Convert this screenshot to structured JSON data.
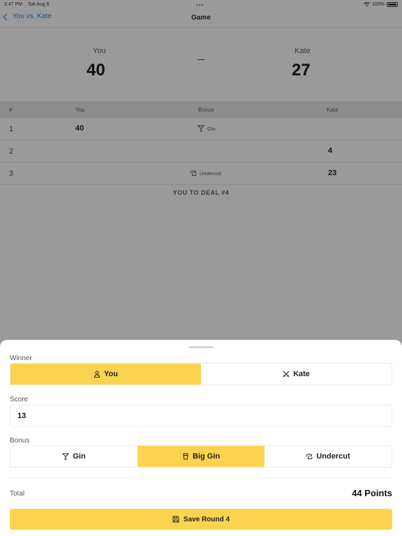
{
  "status_bar": {
    "time": "2:47 PM",
    "date": "Sat Aug 6",
    "battery": "100%"
  },
  "nav": {
    "back_label": "You vs. Kate",
    "title": "Game"
  },
  "scoreboard": {
    "you": {
      "name": "You",
      "score": "40"
    },
    "kate": {
      "name": "Kate",
      "score": "27"
    }
  },
  "table": {
    "headers": {
      "num": "#",
      "you": "You",
      "bonus": "Bonus",
      "kate": "Kate"
    },
    "rows": [
      {
        "num": "1",
        "you": "40",
        "bonus": "Gin",
        "bonus_icon": "cocktail-icon",
        "kate": ""
      },
      {
        "num": "2",
        "you": "",
        "bonus": "",
        "bonus_icon": "",
        "kate": "4"
      },
      {
        "num": "3",
        "you": "",
        "bonus": "Undercut",
        "bonus_icon": "hand-icon",
        "kate": "23"
      }
    ],
    "deal_note": "YOU TO DEAL #4"
  },
  "sheet": {
    "winner_label": "Winner",
    "winner_options": [
      {
        "label": "You",
        "icon": "person-icon",
        "selected": true
      },
      {
        "label": "Kate",
        "icon": "swords-icon",
        "selected": false
      }
    ],
    "score_label": "Score",
    "score_value": "13",
    "bonus_label": "Bonus",
    "bonus_options": [
      {
        "label": "Gin",
        "icon": "cocktail-icon",
        "selected": false
      },
      {
        "label": "Big Gin",
        "icon": "glass-icon",
        "selected": true
      },
      {
        "label": "Undercut",
        "icon": "hand-icon",
        "selected": false
      }
    ],
    "total_label": "Total",
    "total_value": "44 Points",
    "save_label": "Save Round 4",
    "accent_color": "#fcd34f"
  }
}
